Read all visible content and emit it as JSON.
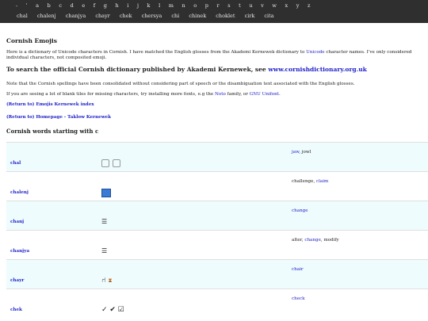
{
  "nav": {
    "letters": [
      "-",
      "'",
      "a",
      "b",
      "c",
      "d",
      "e",
      "f",
      "g",
      "h",
      "i",
      "j",
      "k",
      "l",
      "m",
      "n",
      "o",
      "p",
      "r",
      "s",
      "t",
      "u",
      "v",
      "w",
      "x",
      "y",
      "z"
    ],
    "words": [
      "chal",
      "chalenj",
      "chanjya",
      "chayr",
      "chek",
      "chersya",
      "chi",
      "chinek",
      "choklet",
      "cirk",
      "cita"
    ]
  },
  "page": {
    "title": "Cornish Emojis",
    "intro_1": "Here is a dictionary of Unicode characters in Cornish. I have matched the English glosses from the Akademi Kernewek dictionary to",
    "intro_link": "Unicode",
    "intro_2": "character names. I've only considered individual characters, not composited emoji.",
    "search_heading_text": "To search the official Cornish dictionary published by Akademi Kernewek, see",
    "search_link": "www.cornishdictionary.org.uk",
    "note_1": "Note that the Cornish spellings have been consolidated without considering part of speech or the disambiguation text associated with the English glosses.",
    "note_2a": "If you are seeing a lot of blank tiles for missing characters, try installing more fonts, e.g the",
    "note_2_noto": "Noto",
    "note_2b": "family, or",
    "note_2_gnu": "GNU Unifont",
    "note_2c": ".",
    "link_emojis_index": "(Return to) Emojis Kernewek index",
    "link_homepage": "(Return to) Homepage - Taklow Kernewek",
    "section_heading": "Cornish words starting with c"
  },
  "rows": [
    {
      "word": "chal",
      "emoji": "jaw icons",
      "gloss": [
        {
          "t": "jaw",
          "link": true
        },
        {
          "t": ", jowl",
          "link": false
        }
      ]
    },
    {
      "word": "chalenj",
      "emoji": "film frames",
      "gloss": [
        {
          "t": "challenge, ",
          "link": false
        },
        {
          "t": "claim",
          "link": true
        }
      ]
    },
    {
      "word": "chanj",
      "emoji": "change lines",
      "gloss": [
        {
          "t": "change",
          "link": true
        }
      ]
    },
    {
      "word": "chanjya",
      "emoji": "change lines",
      "gloss": [
        {
          "t": "alter, ",
          "link": false
        },
        {
          "t": "change",
          "link": true
        },
        {
          "t": ", modify",
          "link": false
        }
      ]
    },
    {
      "word": "chayr",
      "emoji": "chair",
      "gloss": [
        {
          "t": "chair",
          "link": true
        }
      ]
    },
    {
      "word": "chek",
      "emoji": "check marks",
      "gloss": [
        {
          "t": "check",
          "link": true
        }
      ]
    }
  ]
}
